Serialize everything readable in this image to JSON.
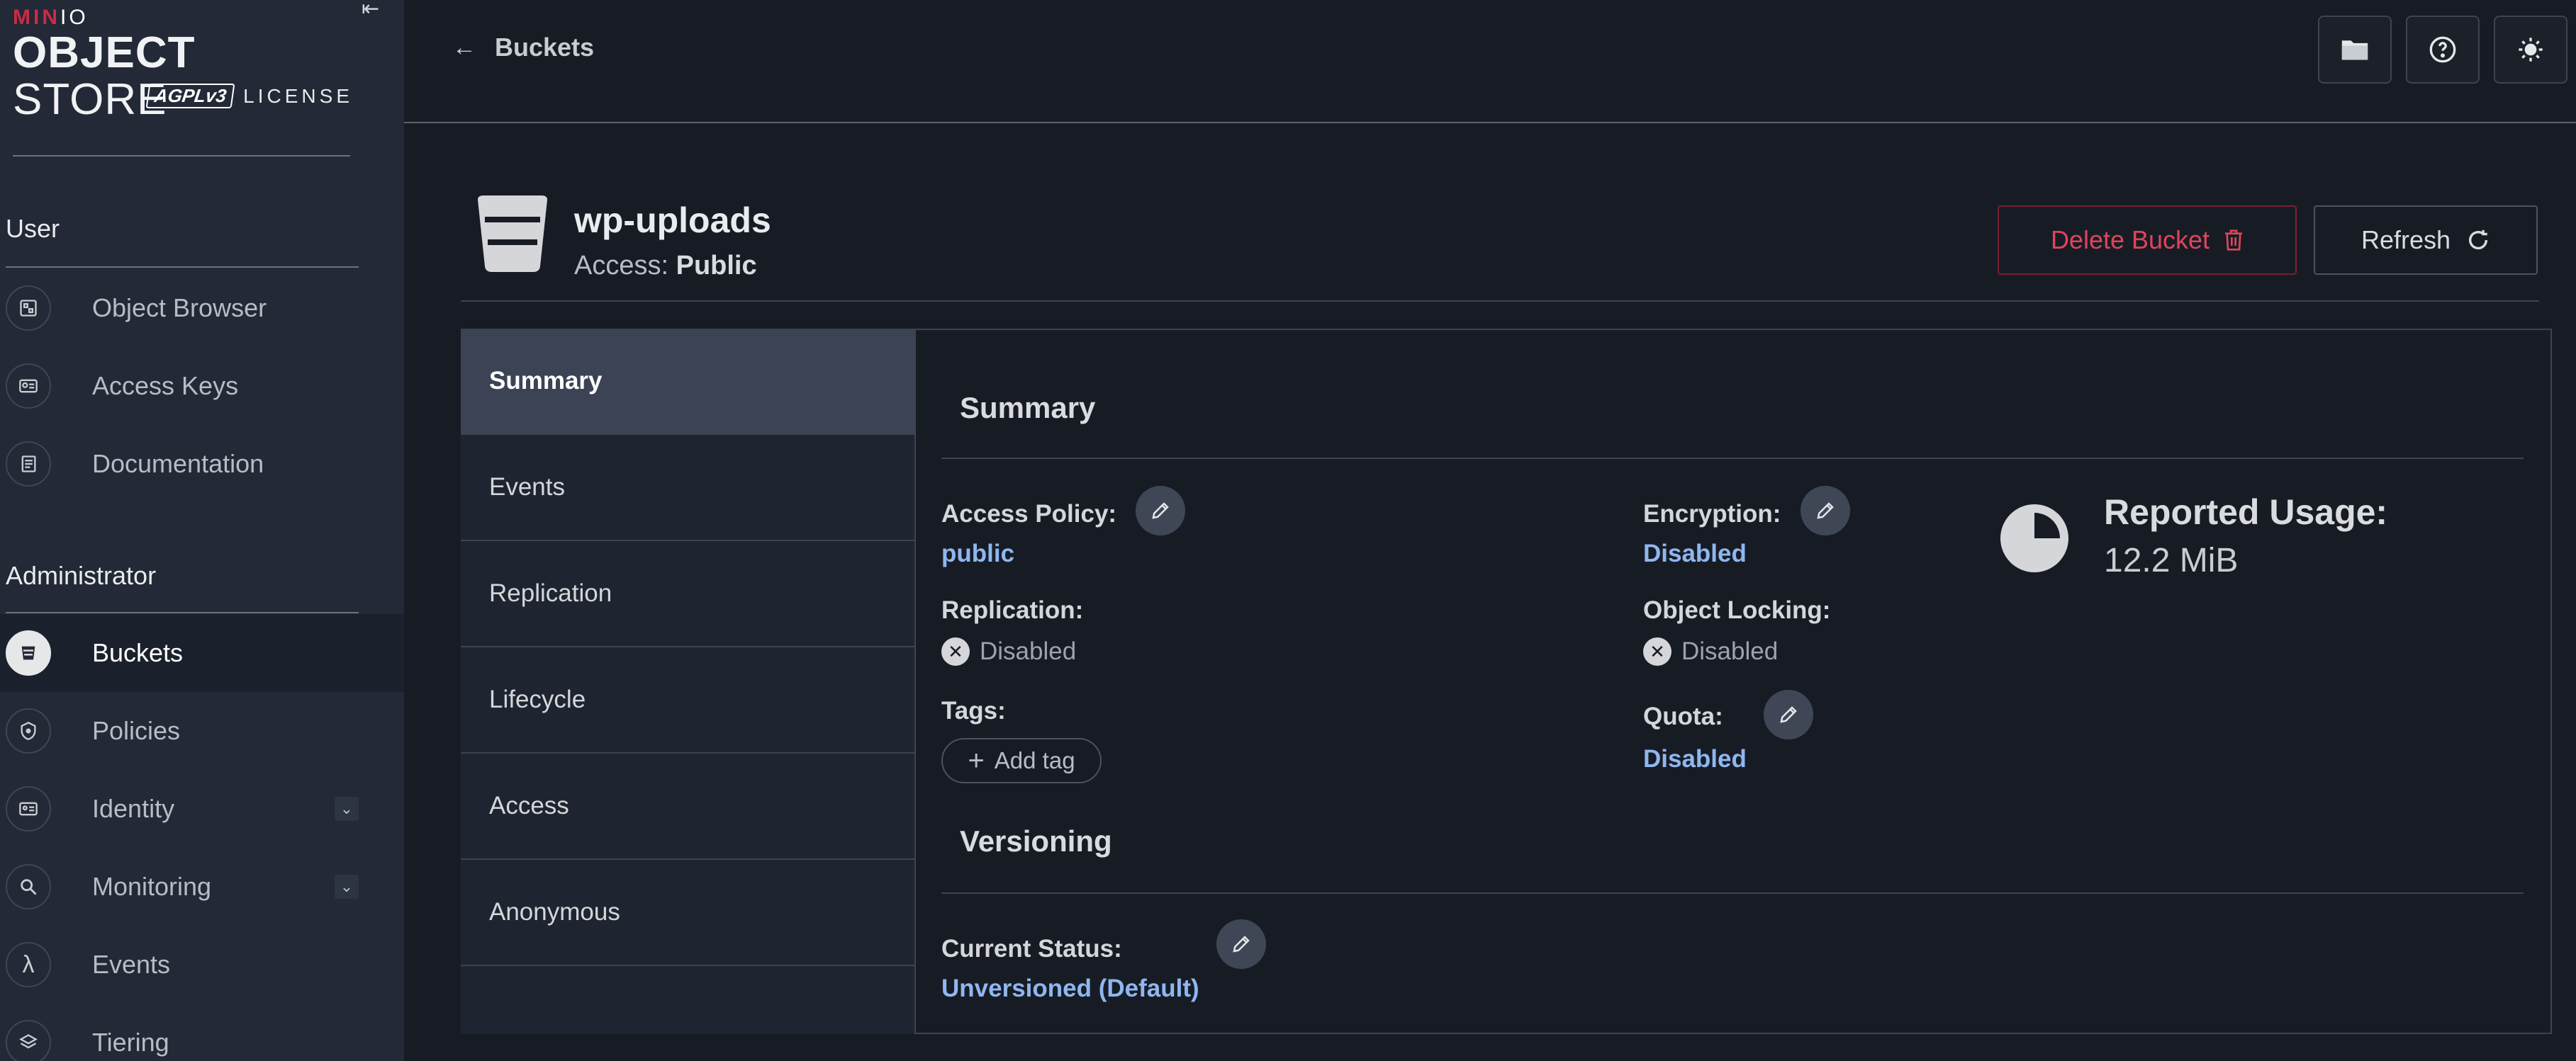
{
  "sidebar": {
    "brand": {
      "prefix": "MIN",
      "suffix": "IO"
    },
    "product": {
      "bold": "OBJECT",
      "rest": " STORE"
    },
    "license_badge": "AGPLv3",
    "license_text": "LICENSE",
    "collapse_icon": "collapse-left-icon",
    "sections": [
      {
        "heading": "User",
        "items": [
          {
            "label": "Object Browser",
            "icon": "object-browser-icon"
          },
          {
            "label": "Access Keys",
            "icon": "access-keys-icon"
          },
          {
            "label": "Documentation",
            "icon": "documentation-icon"
          }
        ]
      },
      {
        "heading": "Administrator",
        "items": [
          {
            "label": "Buckets",
            "icon": "bucket-icon",
            "active": true
          },
          {
            "label": "Policies",
            "icon": "shield-icon"
          },
          {
            "label": "Identity",
            "icon": "id-card-icon",
            "expandable": true
          },
          {
            "label": "Monitoring",
            "icon": "monitor-search-icon",
            "expandable": true
          },
          {
            "label": "Events",
            "icon": "lambda-icon"
          },
          {
            "label": "Tiering",
            "icon": "layers-icon"
          }
        ]
      }
    ]
  },
  "topbar": {
    "back_label": "Buckets",
    "buttons": [
      "folder-icon",
      "help-icon",
      "theme-toggle-icon"
    ]
  },
  "bucket": {
    "name": "wp-uploads",
    "access_label": "Access:",
    "access_value": "Public",
    "delete_label": "Delete Bucket",
    "refresh_label": "Refresh"
  },
  "tabs": [
    "Summary",
    "Events",
    "Replication",
    "Lifecycle",
    "Access",
    "Anonymous"
  ],
  "active_tab": "Summary",
  "summary": {
    "title": "Summary",
    "access_policy_label": "Access Policy:",
    "access_policy_value": "public",
    "replication_label": "Replication:",
    "replication_value": "Disabled",
    "tags_label": "Tags:",
    "add_tag_label": "Add tag",
    "encryption_label": "Encryption:",
    "encryption_value": "Disabled",
    "object_locking_label": "Object Locking:",
    "object_locking_value": "Disabled",
    "quota_label": "Quota:",
    "quota_value": "Disabled",
    "usage_title": "Reported Usage:",
    "usage_value": "12.2 MiB"
  },
  "versioning": {
    "title": "Versioning",
    "status_label": "Current Status:",
    "status_value": "Unversioned (Default)"
  },
  "colors": {
    "background": "#171c24",
    "sidebar": "#232936",
    "link": "#8fb6f0",
    "danger": "#e0445d"
  }
}
